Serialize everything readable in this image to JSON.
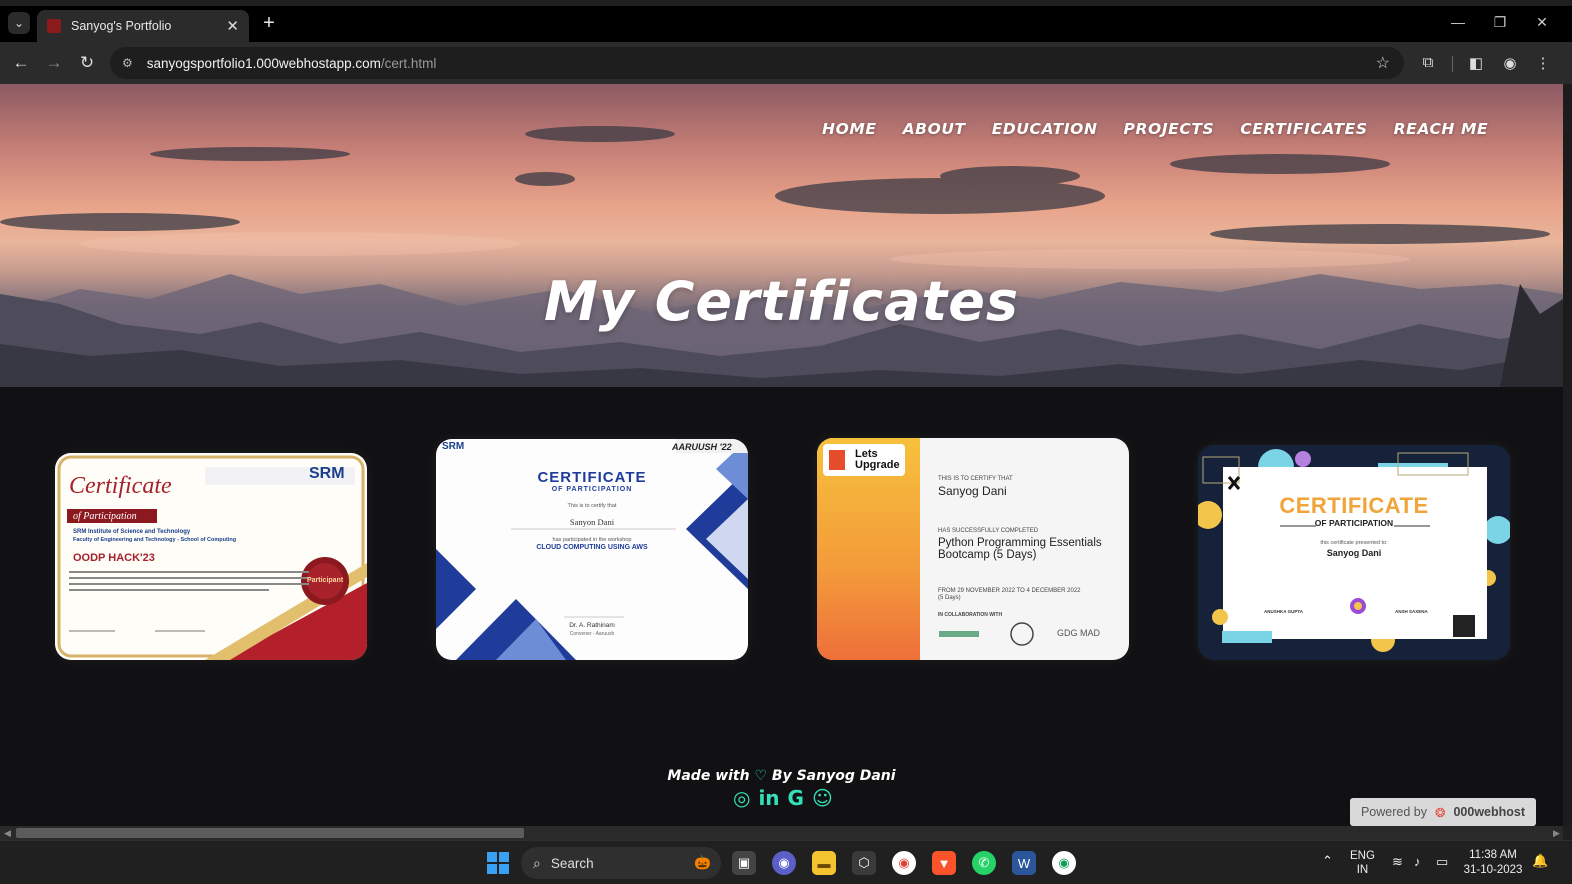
{
  "browser": {
    "tab_title": "Sanyog's Portfolio",
    "tab_close": "✕",
    "new_tab": "+",
    "url_host": "sanyogsportfolio1.000webhostapp.com",
    "url_path": "/cert.html"
  },
  "page": {
    "nav": [
      "HOME",
      "ABOUT",
      "EDUCATION",
      "PROJECTS",
      "CERTIFICATES",
      "REACH ME"
    ],
    "hero_title": "My Certificates",
    "footer_prefix": "Made with",
    "footer_suffix": "By Sanyog Dani",
    "social": [
      "instagram-icon",
      "linkedin-icon",
      "google-icon",
      "github-icon"
    ],
    "powered_by_label": "Powered by",
    "powered_by_brand": "000webhost"
  },
  "certificates": [
    {
      "title": "Certificate",
      "subtitle": "of Participation",
      "org": "SRM Institute of Science and Technology",
      "dept": "Faculty of Engineering and Technology - School of Computing",
      "event": "OODP HACK'23",
      "seal": "Participant",
      "logo": "SRM"
    },
    {
      "title": "CERTIFICATE",
      "subtitle": "OF PARTICIPATION",
      "certify": "This is to certify that",
      "name": "Sanyon Dani",
      "line1": "has participated in the workshop",
      "workshop": "CLOUD COMPUTING USING AWS",
      "signer": "Dr. A. Rathinam",
      "signer_role": "Convener - Aaruush",
      "badge": "AARUUSH '22",
      "logo": "SRM"
    },
    {
      "brand": "Lets Upgrade",
      "certify": "THIS IS TO CERTIFY THAT",
      "name": "Sanyog Dani",
      "completed": "HAS SUCCESSFULLY COMPLETED",
      "course": "Python Programming Essentials Bootcamp (5 Days)",
      "dates": "FROM 29 NOVEMBER 2022 TO 4 DECEMBER 2022",
      "days": "(5 Days)",
      "collab": "IN COLLABORATION WITH",
      "partner": "GDG MAD"
    },
    {
      "title": "CERTIFICATE",
      "subtitle": "OF PARTICIPATION",
      "presented": "this certificate presented to:",
      "name": "Sanyog Dani",
      "signer1": "ANUSHKA GUPTA",
      "signer2": "ANSH SAXENA"
    }
  ],
  "taskbar": {
    "search": "Search",
    "lang1": "ENG",
    "lang2": "IN",
    "time": "11:38 AM",
    "date": "31-10-2023"
  },
  "colors": {
    "accent_social": "#35e0b8",
    "page_bg": "#111113"
  }
}
